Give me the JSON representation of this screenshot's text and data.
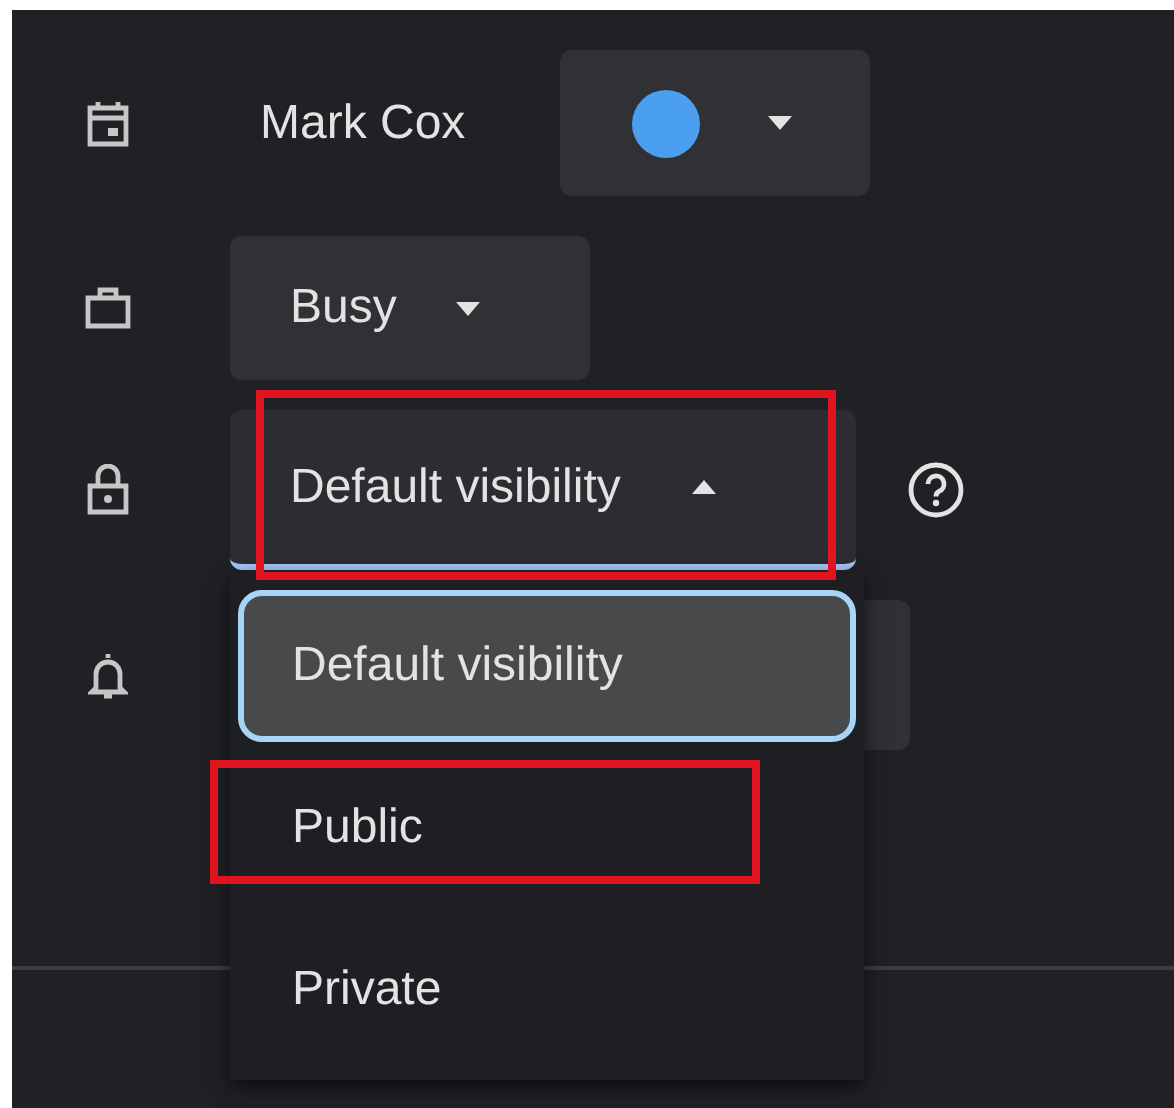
{
  "calendar": {
    "owner": "Mark Cox",
    "color": "#4a9ff0"
  },
  "availability": {
    "value": "Busy"
  },
  "visibility": {
    "value": "Default visibility",
    "expanded": true,
    "highlighted": true,
    "options": [
      {
        "label": "Default visibility",
        "selected": true,
        "highlighted": false
      },
      {
        "label": "Public",
        "selected": false,
        "highlighted": true
      },
      {
        "label": "Private",
        "selected": false,
        "highlighted": false
      }
    ]
  }
}
